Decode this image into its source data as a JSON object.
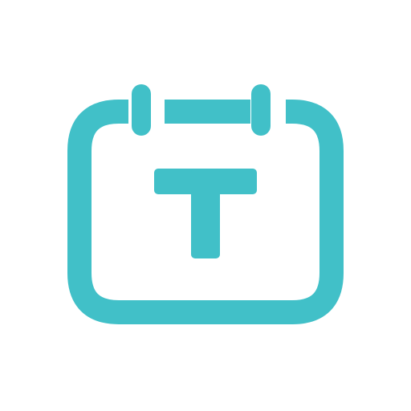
{
  "logo": {
    "icon": "calendar-t-icon",
    "glyph": "T",
    "color": "#41c0c8",
    "background": "#ffffff"
  }
}
